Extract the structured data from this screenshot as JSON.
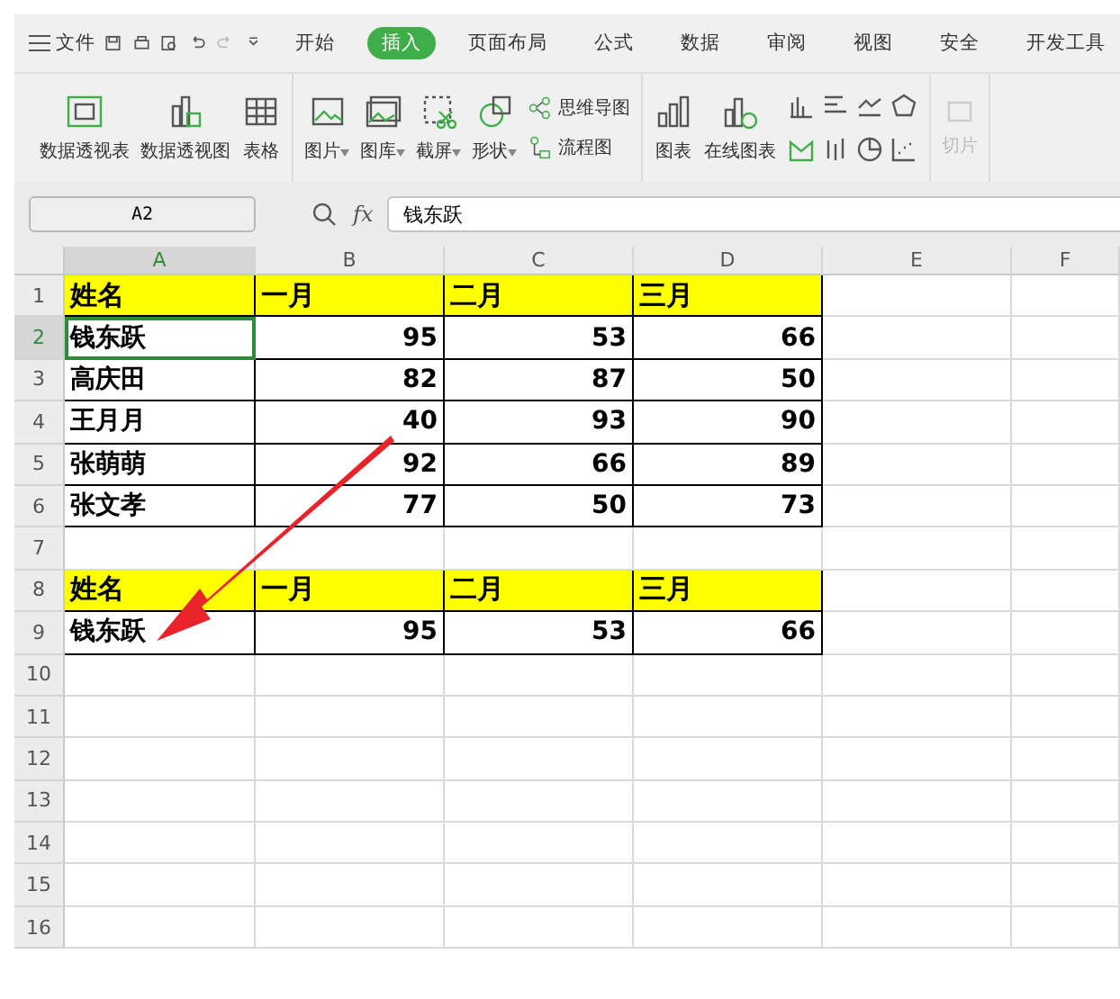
{
  "menu": {
    "file": "文件",
    "tabs": [
      {
        "label": "开始",
        "selected": false
      },
      {
        "label": "插入",
        "selected": true
      },
      {
        "label": "页面布局",
        "selected": false
      },
      {
        "label": "公式",
        "selected": false
      },
      {
        "label": "数据",
        "selected": false
      },
      {
        "label": "审阅",
        "selected": false
      },
      {
        "label": "视图",
        "selected": false
      },
      {
        "label": "安全",
        "selected": false
      },
      {
        "label": "开发工具",
        "selected": false
      }
    ]
  },
  "ribbon": {
    "large": [
      {
        "label": "数据透视表",
        "kind": "pivot"
      },
      {
        "label": "数据透视图",
        "kind": "pivotchart"
      },
      {
        "label": "表格",
        "kind": "table"
      },
      {
        "label": "图片",
        "kind": "picture",
        "dropdown": true
      },
      {
        "label": "图库",
        "kind": "gallery",
        "dropdown": true
      },
      {
        "label": "截屏",
        "kind": "screenshot",
        "dropdown": true
      },
      {
        "label": "形状",
        "kind": "shapes",
        "dropdown": true
      }
    ],
    "small": [
      {
        "label": "思维导图",
        "kind": "mindmap"
      },
      {
        "label": "流程图",
        "kind": "flow"
      }
    ],
    "charts": [
      {
        "label": "图表",
        "kind": "chart"
      },
      {
        "label": "在线图表",
        "kind": "onlinechart"
      }
    ],
    "disabled": {
      "label": "切片",
      "disabled": true
    }
  },
  "formula_bar": {
    "name_box": "A2",
    "fx": "fx",
    "value": "钱东跃"
  },
  "columns": [
    {
      "label": "A",
      "selected": true
    },
    {
      "label": "B",
      "selected": false
    },
    {
      "label": "C",
      "selected": false
    },
    {
      "label": "D",
      "selected": false
    },
    {
      "label": "E",
      "selected": false
    },
    {
      "label": "F",
      "selected": false
    }
  ],
  "rows": [
    {
      "number": "1",
      "selected": false,
      "header": true,
      "cells": [
        "姓名",
        "一月",
        "二月",
        "三月"
      ]
    },
    {
      "number": "2",
      "selected": true,
      "header": false,
      "cells": [
        "钱东跃",
        "95",
        "53",
        "66"
      ]
    },
    {
      "number": "3",
      "selected": false,
      "header": false,
      "cells": [
        "高庆田",
        "82",
        "87",
        "50"
      ]
    },
    {
      "number": "4",
      "selected": false,
      "header": false,
      "cells": [
        "王月月",
        "40",
        "93",
        "90"
      ]
    },
    {
      "number": "5",
      "selected": false,
      "header": false,
      "cells": [
        "张萌萌",
        "92",
        "66",
        "89"
      ]
    },
    {
      "number": "6",
      "selected": false,
      "header": false,
      "cells": [
        "张文孝",
        "77",
        "50",
        "73"
      ]
    },
    {
      "number": "7",
      "selected": false,
      "header": false,
      "cells": []
    },
    {
      "number": "8",
      "selected": false,
      "header": true,
      "cells": [
        "姓名",
        "一月",
        "二月",
        "三月"
      ]
    },
    {
      "number": "9",
      "selected": false,
      "header": false,
      "cells": [
        "钱东跃",
        "95",
        "53",
        "66"
      ]
    },
    {
      "number": "10",
      "selected": false,
      "header": false,
      "cells": []
    },
    {
      "number": "11",
      "selected": false,
      "header": false,
      "cells": []
    },
    {
      "number": "12",
      "selected": false,
      "header": false,
      "cells": []
    },
    {
      "number": "13",
      "selected": false,
      "header": false,
      "cells": []
    },
    {
      "number": "14",
      "selected": false,
      "header": false,
      "cells": []
    },
    {
      "number": "15",
      "selected": false,
      "header": false,
      "cells": []
    },
    {
      "number": "16",
      "selected": false,
      "header": false,
      "cells": []
    }
  ]
}
